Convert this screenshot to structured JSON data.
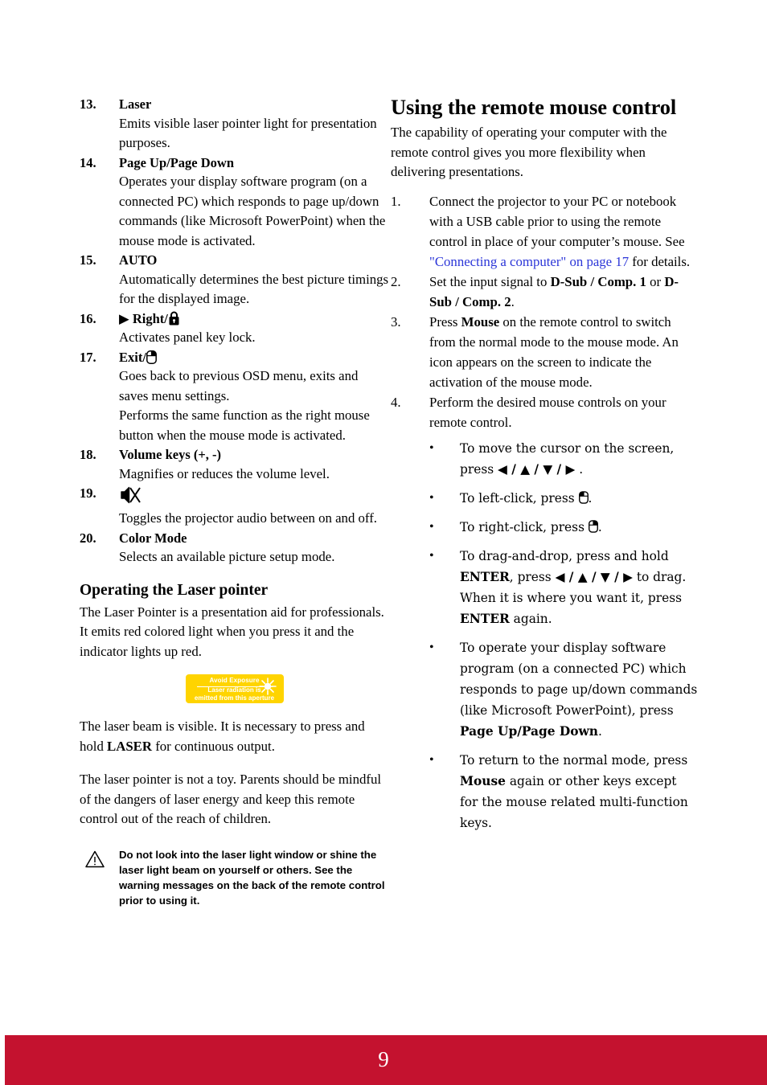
{
  "page": {
    "number": "9",
    "footer_color": "#c4122f"
  },
  "left_column": {
    "items": [
      {
        "num": "13.",
        "title": "Laser",
        "title_icon": null,
        "desc": [
          "Emits visible laser pointer light for presentation purposes."
        ]
      },
      {
        "num": "14.",
        "title": "Page Up/Page Down",
        "title_icon": null,
        "desc": [
          "Operates your display software program (on a connected PC) which responds to page up/down commands (like Microsoft PowerPoint) when the mouse mode is activated."
        ]
      },
      {
        "num": "15.",
        "title": "AUTO",
        "title_icon": null,
        "desc": [
          "Automatically determines the best picture timings for the displayed image."
        ]
      },
      {
        "num": "16.",
        "title": "▶ Right/",
        "title_icon": "lock-icon",
        "desc": [
          "Activates panel key lock."
        ]
      },
      {
        "num": "17.",
        "title": "Exit/",
        "title_icon": "mouse-right-click-icon",
        "desc": [
          "Goes back to previous OSD menu, exits and saves menu settings.",
          "Performs the same function as the right mouse button when the mouse mode is activated."
        ]
      },
      {
        "num": "18.",
        "title": "Volume keys (+, -)",
        "title_icon": null,
        "desc": [
          "Magnifies or reduces the volume level."
        ]
      },
      {
        "num": "19.",
        "title": "",
        "title_icon": "speaker-mute-icon",
        "desc": [
          "Toggles the projector audio between on and off."
        ]
      },
      {
        "num": "20.",
        "title": "Color Mode",
        "title_icon": null,
        "desc": [
          "Selects an available picture setup mode."
        ]
      }
    ],
    "laser_section": {
      "heading": "Operating the Laser pointer",
      "intro": "The Laser Pointer is a presentation aid for professionals. It emits red colored light when you press it and the indicator lights up red.",
      "label_graphic": {
        "top_text": "Avoid Exposure",
        "bottom_line1": "Laser radiation is",
        "bottom_line2": "emitted from this aperture",
        "background_color": "#ffd400",
        "text_color": "#ffffff"
      },
      "para_visible_pre": "The laser beam is visible. It is necessary to press and hold ",
      "para_visible_bold": "LASER",
      "para_visible_post": " for continuous output.",
      "para_toy": "The laser pointer is not a toy. Parents should be mindful of the dangers of laser energy and keep this remote control out of the reach of children.",
      "caution": "Do not look into the laser light window or shine the laser light beam on yourself or others. See the warning messages on the back of the remote control prior to using it."
    }
  },
  "right_column": {
    "heading": "Using the remote mouse control",
    "intro": "The capability of operating your computer with the remote control gives you more flexibility when delivering presentations.",
    "steps": [
      {
        "num": "1.",
        "pre": "Connect the projector to your PC or notebook with a USB cable prior to using the remote control in place of your computer’s mouse. See ",
        "link": "\"Connecting a computer\" on page 17",
        "post": " for details."
      },
      {
        "num": "2.",
        "pre": "Set the input signal to ",
        "bold1": "D-Sub / Comp. 1",
        "mid": " or ",
        "bold2": "D-Sub / Comp. 2",
        "post": "."
      },
      {
        "num": "3.",
        "pre": "Press ",
        "bold1": "Mouse",
        "post": " on the remote control to switch from the normal mode to the mouse mode. An icon appears on the screen to indicate the activation of the mouse mode."
      },
      {
        "num": "4.",
        "pre": "Perform the desired mouse controls on your remote control."
      }
    ],
    "bullets": [
      {
        "id": "move-cursor",
        "pre": "To move the cursor on the screen, press ",
        "arrows": "◀ / ▲ / ▼ / ▶",
        "post": " ."
      },
      {
        "id": "left-click",
        "pre": "To left-click, press ",
        "icon": "mouse-left-click-icon",
        "post": "."
      },
      {
        "id": "right-click",
        "pre": "To right-click, press ",
        "icon": "mouse-right-click-icon",
        "post": "."
      },
      {
        "id": "drag-and-drop",
        "pre": "To drag-and-drop, press and hold ",
        "bold1": "ENTER",
        "mid": ", press ",
        "arrows": "◀ / ▲ / ▼ / ▶",
        "mid2": " to drag. When it is where you want it, press ",
        "bold2": "ENTER",
        "post": " again."
      },
      {
        "id": "page-up-down",
        "pre": "To operate your display software program (on a connected PC) which responds to page up/down commands (like Microsoft PowerPoint), press ",
        "bold1": "Page Up/Page Down",
        "post": "."
      },
      {
        "id": "normal-mode",
        "pre": "To return to the normal mode, press ",
        "bold1": "Mouse",
        "post": " again or other keys except for the mouse related multi-function keys."
      }
    ]
  }
}
